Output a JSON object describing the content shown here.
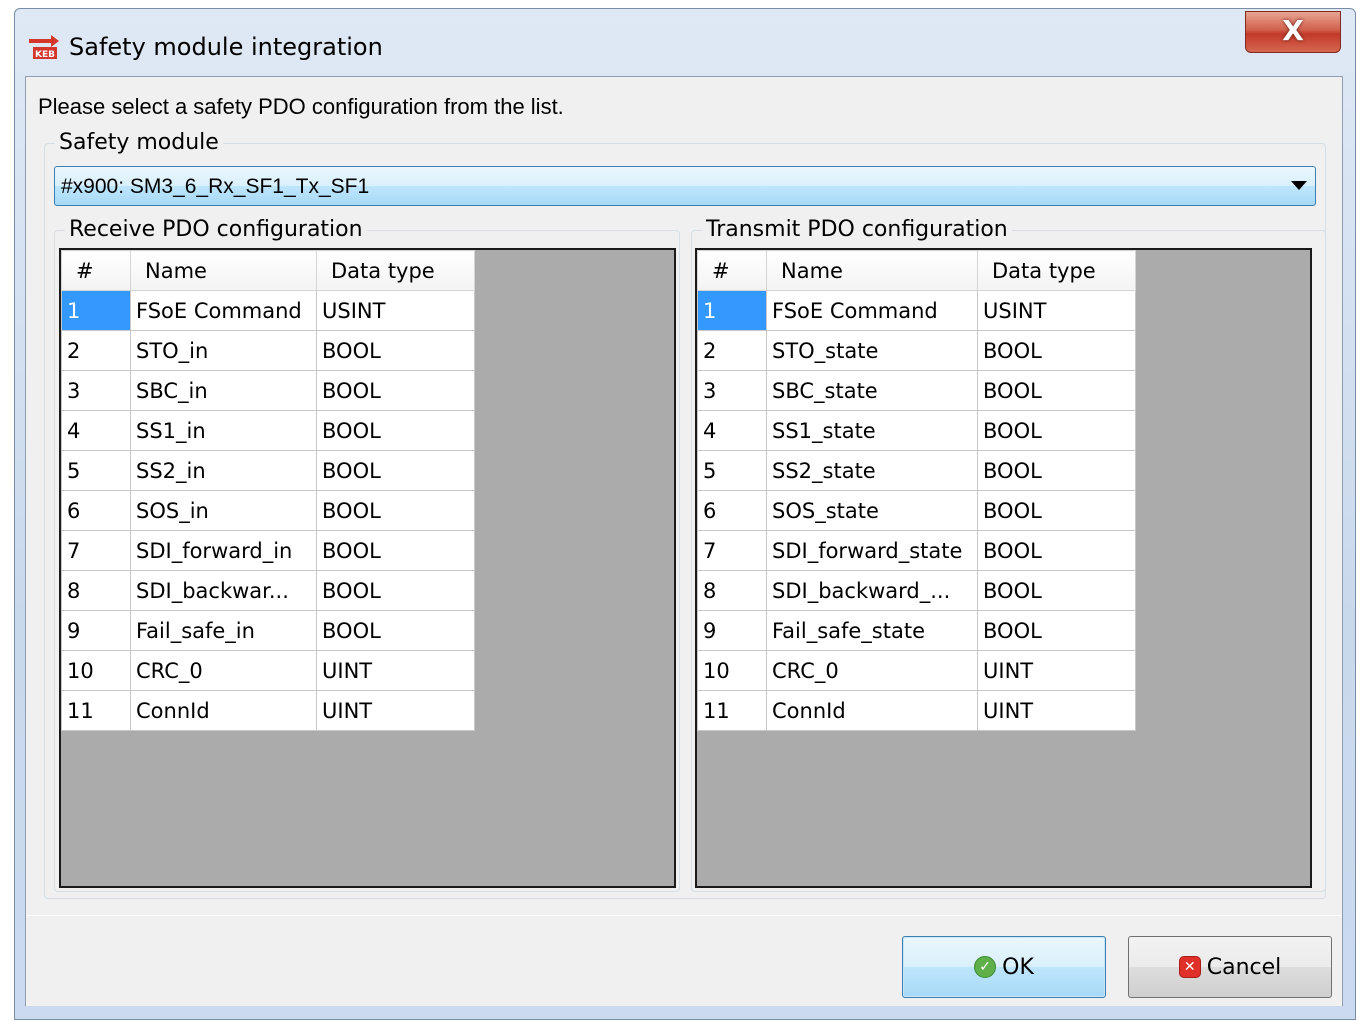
{
  "window": {
    "title": "Safety module integration",
    "close_label": "X"
  },
  "instruction": "Please select a safety PDO configuration from the list.",
  "safety_module": {
    "group_label": "Safety module",
    "selected": "#x900: SM3_6_Rx_SF1_Tx_SF1"
  },
  "receive": {
    "group_label": "Receive PDO configuration",
    "columns": [
      "#",
      "Name",
      "Data type"
    ],
    "rows": [
      [
        "1",
        "FSoE Command",
        "USINT"
      ],
      [
        "2",
        "STO_in",
        "BOOL"
      ],
      [
        "3",
        "SBC_in",
        "BOOL"
      ],
      [
        "4",
        "SS1_in",
        "BOOL"
      ],
      [
        "5",
        "SS2_in",
        "BOOL"
      ],
      [
        "6",
        "SOS_in",
        "BOOL"
      ],
      [
        "7",
        "SDI_forward_in",
        "BOOL"
      ],
      [
        "8",
        "SDI_backwar...",
        "BOOL"
      ],
      [
        "9",
        "Fail_safe_in",
        "BOOL"
      ],
      [
        "10",
        "CRC_0",
        "UINT"
      ],
      [
        "11",
        "ConnId",
        "UINT"
      ]
    ]
  },
  "transmit": {
    "group_label": "Transmit PDO configuration",
    "columns": [
      "#",
      "Name",
      "Data type"
    ],
    "rows": [
      [
        "1",
        "FSoE Command",
        "USINT"
      ],
      [
        "2",
        "STO_state",
        "BOOL"
      ],
      [
        "3",
        "SBC_state",
        "BOOL"
      ],
      [
        "4",
        "SS1_state",
        "BOOL"
      ],
      [
        "5",
        "SS2_state",
        "BOOL"
      ],
      [
        "6",
        "SOS_state",
        "BOOL"
      ],
      [
        "7",
        "SDI_forward_state",
        "BOOL"
      ],
      [
        "8",
        "SDI_backward_...",
        "BOOL"
      ],
      [
        "9",
        "Fail_safe_state",
        "BOOL"
      ],
      [
        "10",
        "CRC_0",
        "UINT"
      ],
      [
        "11",
        "ConnId",
        "UINT"
      ]
    ]
  },
  "buttons": {
    "ok": "OK",
    "cancel": "Cancel"
  },
  "icons": {
    "app": "keb-app-icon",
    "ok": "check-circle-icon",
    "cancel": "x-square-icon",
    "dropdown": "chevron-down-icon"
  },
  "colors": {
    "selection": "#3399ff",
    "grid_background": "#ababab",
    "close_button": "#c2392a",
    "focus_border": "#3c7fb1"
  }
}
